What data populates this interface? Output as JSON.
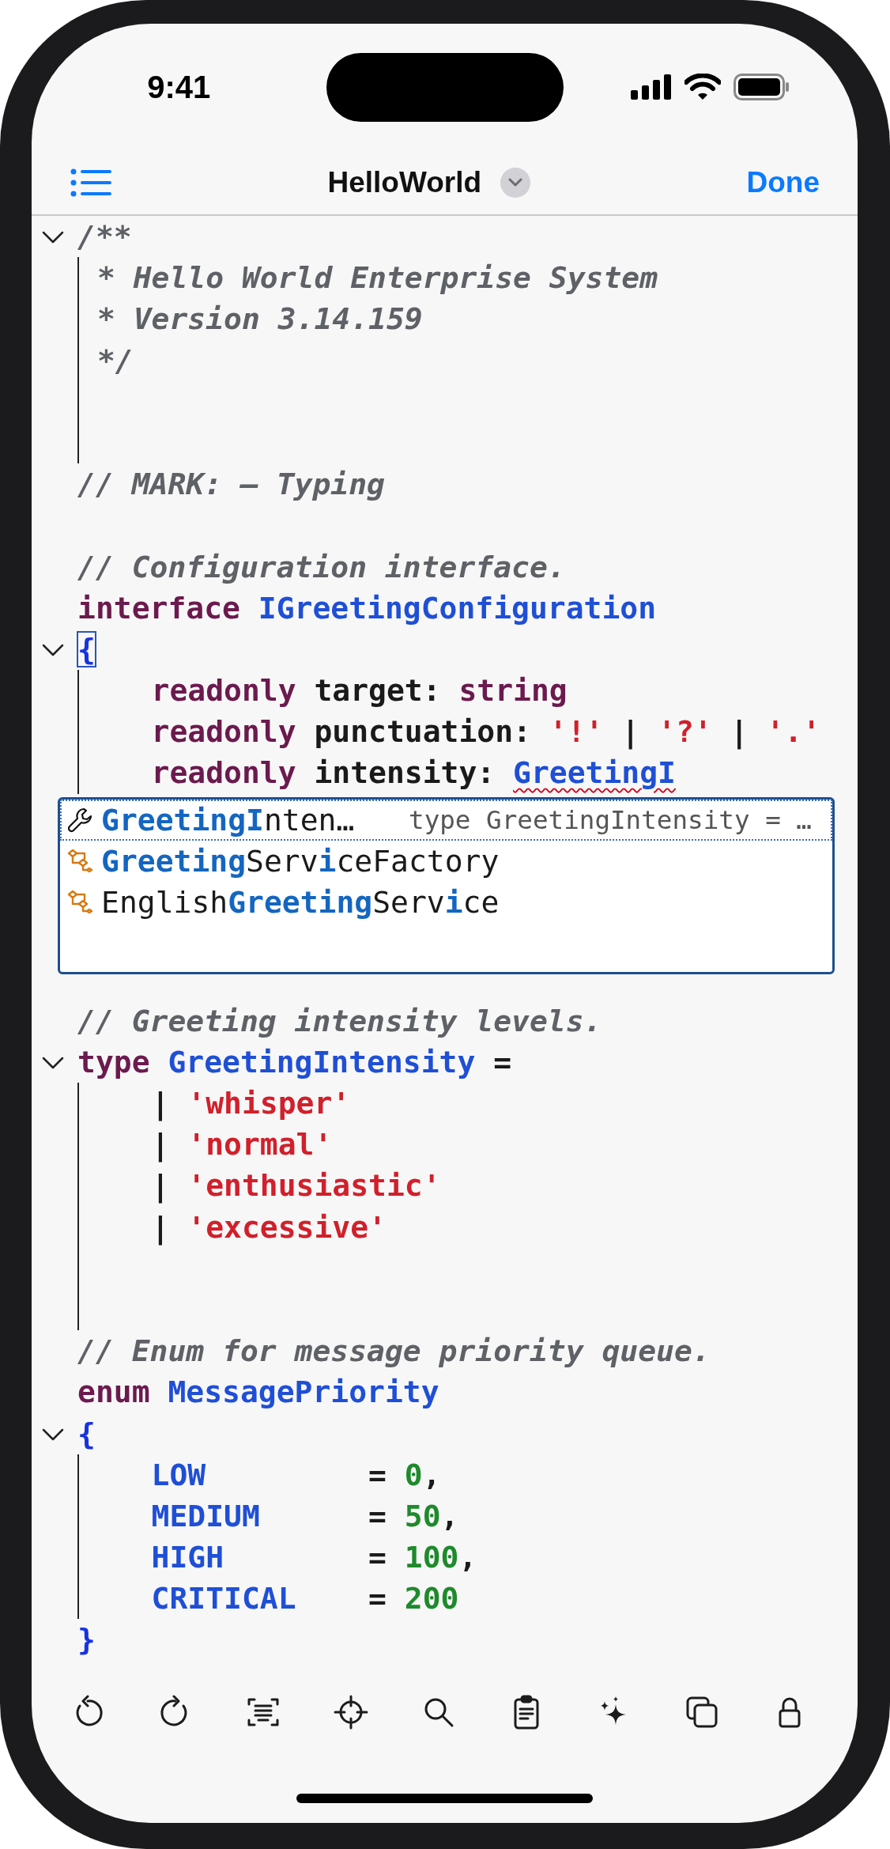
{
  "status_bar": {
    "time": "9:41"
  },
  "nav_bar": {
    "title": "HelloWorld",
    "done": "Done"
  },
  "code_top": [
    {
      "tokens": [
        {
          "text": "/**",
          "kind": "comment"
        }
      ],
      "expanded": true,
      "children": [
        {
          "tokens": [
            {
              "text": " * Hello World Enterprise System",
              "kind": "comment"
            }
          ]
        },
        {
          "tokens": [
            {
              "text": " * Version 3.14.159",
              "kind": "comment"
            }
          ]
        },
        {
          "tokens": [
            {
              "text": " */",
              "kind": "comment"
            }
          ]
        },
        {
          "kind": "blank"
        },
        {
          "kind": "blank"
        }
      ]
    },
    {
      "tokens": [
        {
          "text": "// MARK: – Typing",
          "kind": "comment"
        }
      ]
    },
    {
      "kind": "blank"
    },
    {
      "tokens": [
        {
          "text": "// Configuration interface.",
          "kind": "comment"
        }
      ]
    },
    {
      "tokens": [
        {
          "text": "interface ",
          "kind": "keyword"
        },
        {
          "text": "IGreetingConfiguration",
          "kind": "type",
          "error": false
        }
      ]
    },
    {
      "tokens": [
        {
          "text": "{",
          "kind": "brace",
          "matched": true
        }
      ],
      "expanded": true,
      "children": [
        {
          "tokens": [
            {
              "text": "    readonly",
              "kind": "keyword"
            },
            {
              "text": " target: ",
              "kind": "plain"
            },
            {
              "text": "string",
              "kind": "keyword"
            }
          ]
        },
        {
          "tokens": [
            {
              "text": "    readonly",
              "kind": "keyword"
            },
            {
              "text": " punctuation: ",
              "kind": "plain"
            },
            {
              "text": "'!'",
              "kind": "string"
            },
            {
              "text": " | ",
              "kind": "plain"
            },
            {
              "text": "'?'",
              "kind": "string"
            },
            {
              "text": " | ",
              "kind": "plain"
            },
            {
              "text": "'.'",
              "kind": "string"
            }
          ]
        },
        {
          "tokens": [
            {
              "text": "    readonly",
              "kind": "keyword"
            },
            {
              "text": " intensity: ",
              "kind": "plain"
            },
            {
              "text": "GreetingI",
              "kind": "type",
              "error": true
            }
          ]
        }
      ]
    }
  ],
  "completion": {
    "items": [
      {
        "kind": "type",
        "selected": true,
        "segments": [
          {
            "text": "GreetingI",
            "match": true
          },
          {
            "text": "nten…",
            "match": false
          }
        ],
        "detail": "type GreetingIntensity = …"
      },
      {
        "kind": "class",
        "selected": false,
        "segments": [
          {
            "text": "Greeting",
            "match": true
          },
          {
            "text": "Serv",
            "match": false
          },
          {
            "text": "i",
            "match": true
          },
          {
            "text": "ceFactory",
            "match": false
          }
        ]
      },
      {
        "kind": "class",
        "selected": false,
        "segments": [
          {
            "text": "English",
            "match": false
          },
          {
            "text": "Greeting",
            "match": true
          },
          {
            "text": "Serv",
            "match": false
          },
          {
            "text": "i",
            "match": true
          },
          {
            "text": "ce",
            "match": false
          }
        ]
      }
    ]
  },
  "code_bottom": [
    {
      "tokens": [
        {
          "text": "// Greeting intensity levels.",
          "kind": "comment"
        }
      ]
    },
    {
      "tokens": [
        {
          "text": "type ",
          "kind": "keyword"
        },
        {
          "text": "GreetingIntensity",
          "kind": "type",
          "error": false
        },
        {
          "text": " =",
          "kind": "plain"
        }
      ],
      "expanded": true,
      "children": [
        {
          "tokens": [
            {
              "text": "    | ",
              "kind": "plain"
            },
            {
              "text": "'whisper'",
              "kind": "string"
            }
          ]
        },
        {
          "tokens": [
            {
              "text": "    | ",
              "kind": "plain"
            },
            {
              "text": "'normal'",
              "kind": "string"
            }
          ]
        },
        {
          "tokens": [
            {
              "text": "    | ",
              "kind": "plain"
            },
            {
              "text": "'enthusiastic'",
              "kind": "string"
            }
          ]
        },
        {
          "tokens": [
            {
              "text": "    | ",
              "kind": "plain"
            },
            {
              "text": "'excessive'",
              "kind": "string"
            }
          ]
        },
        {
          "kind": "blank"
        },
        {
          "kind": "blank"
        }
      ]
    },
    {
      "tokens": [
        {
          "text": "// Enum for message priority queue.",
          "kind": "comment"
        }
      ]
    },
    {
      "tokens": [
        {
          "text": "enum ",
          "kind": "keyword"
        },
        {
          "text": "MessagePriority",
          "kind": "type",
          "error": false
        }
      ]
    },
    {
      "tokens": [
        {
          "text": "{",
          "kind": "brace",
          "matched": false
        }
      ],
      "expanded": true,
      "children": [
        {
          "tokens": [
            {
              "text": "    LOW",
              "kind": "member"
            },
            {
              "text": "         = ",
              "kind": "plain"
            },
            {
              "text": "0",
              "kind": "number"
            },
            {
              "text": ",",
              "kind": "plain"
            }
          ]
        },
        {
          "tokens": [
            {
              "text": "    MEDIUM",
              "kind": "member"
            },
            {
              "text": "      = ",
              "kind": "plain"
            },
            {
              "text": "50",
              "kind": "number"
            },
            {
              "text": ",",
              "kind": "plain"
            }
          ]
        },
        {
          "tokens": [
            {
              "text": "    HIGH",
              "kind": "member"
            },
            {
              "text": "        = ",
              "kind": "plain"
            },
            {
              "text": "100",
              "kind": "number"
            },
            {
              "text": ",",
              "kind": "plain"
            }
          ]
        },
        {
          "tokens": [
            {
              "text": "    CRITICAL",
              "kind": "member"
            },
            {
              "text": "    = ",
              "kind": "plain"
            },
            {
              "text": "200",
              "kind": "number"
            }
          ]
        }
      ]
    },
    {
      "tokens": [
        {
          "text": "}",
          "kind": "brace",
          "matched": false
        }
      ]
    }
  ]
}
